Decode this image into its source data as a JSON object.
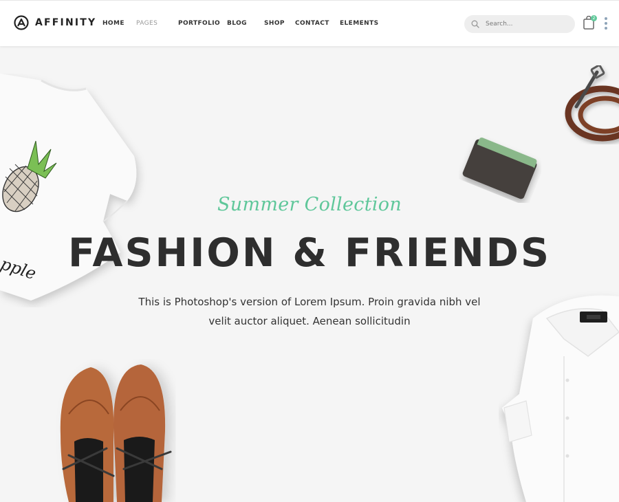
{
  "brand": {
    "name": "AFFINITY",
    "logo_icon": "affinity-logo-icon"
  },
  "nav": {
    "items": [
      {
        "label": "HOME"
      },
      {
        "label": "PAGES"
      },
      {
        "label": "PORTFOLIO"
      },
      {
        "label": "BLOG"
      },
      {
        "label": "SHOP"
      },
      {
        "label": "CONTACT"
      },
      {
        "label": "ELEMENTS"
      }
    ]
  },
  "search": {
    "placeholder": "Search...",
    "icon": "search-icon"
  },
  "cart": {
    "count": "2",
    "icon": "shopping-bag-icon",
    "badge_color": "#62c99b"
  },
  "more": {
    "icon": "vertical-dots-icon"
  },
  "hero": {
    "tagline": "Summer Collection",
    "headline": "FASHION & FRIENDS",
    "description_line1": "This is Photoshop's version  of Lorem Ipsum. Proin gravida nibh vel",
    "description_line2": "velit auctor aliquet. Aenean sollicitudin",
    "accent_color": "#5fc79a",
    "tshirt_print": "pple"
  }
}
